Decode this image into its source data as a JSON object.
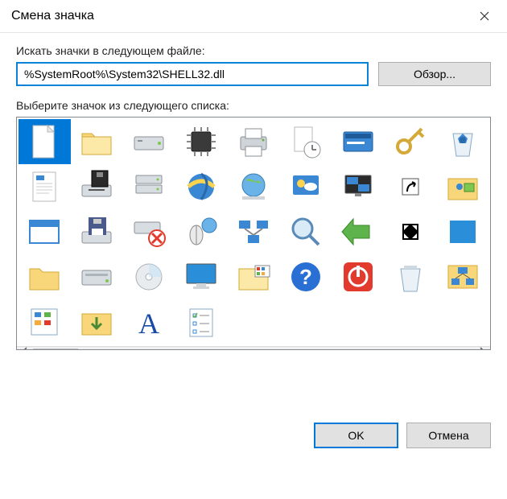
{
  "title": "Смена значка",
  "path_label": "Искать значки в следующем файле:",
  "path_value": "%SystemRoot%\\System32\\SHELL32.dll",
  "browse_label": "Обзор...",
  "list_label": "Выберите значок из следующего списка:",
  "ok_label": "OK",
  "cancel_label": "Отмена",
  "icons": [
    "blank-document",
    "folder",
    "hard-drive",
    "cpu-chip",
    "printer",
    "document-clock",
    "run-dialog",
    "gold-key",
    "recycle-bin-full",
    "control-panel",
    "rich-text-document",
    "floppy-drive",
    "drive-stack",
    "internet-explorer",
    "globe-network",
    "weather",
    "display-checker",
    "shortcut-arrow",
    "folder-user",
    "folder-download",
    "window",
    "save-floppy",
    "drive-error",
    "mouse-globe",
    "network-computers",
    "magnifier",
    "green-arrow-left",
    "fullscreen-arrows",
    "blue-square",
    "font-a",
    "folder-plain",
    "hard-drive-2",
    "optical-disc",
    "monitor",
    "folder-apps",
    "help-question",
    "power-shutdown",
    "recycle-bin-empty",
    "network-chart",
    "checklist"
  ],
  "selected_index": 0,
  "colors": {
    "selection": "#0078d7",
    "folder": "#f7d77a",
    "blue": "#2a8fd8",
    "red": "#e23b2e",
    "green": "#5eb34a",
    "gray": "#cfd4d8",
    "dark": "#4a4a4a"
  }
}
